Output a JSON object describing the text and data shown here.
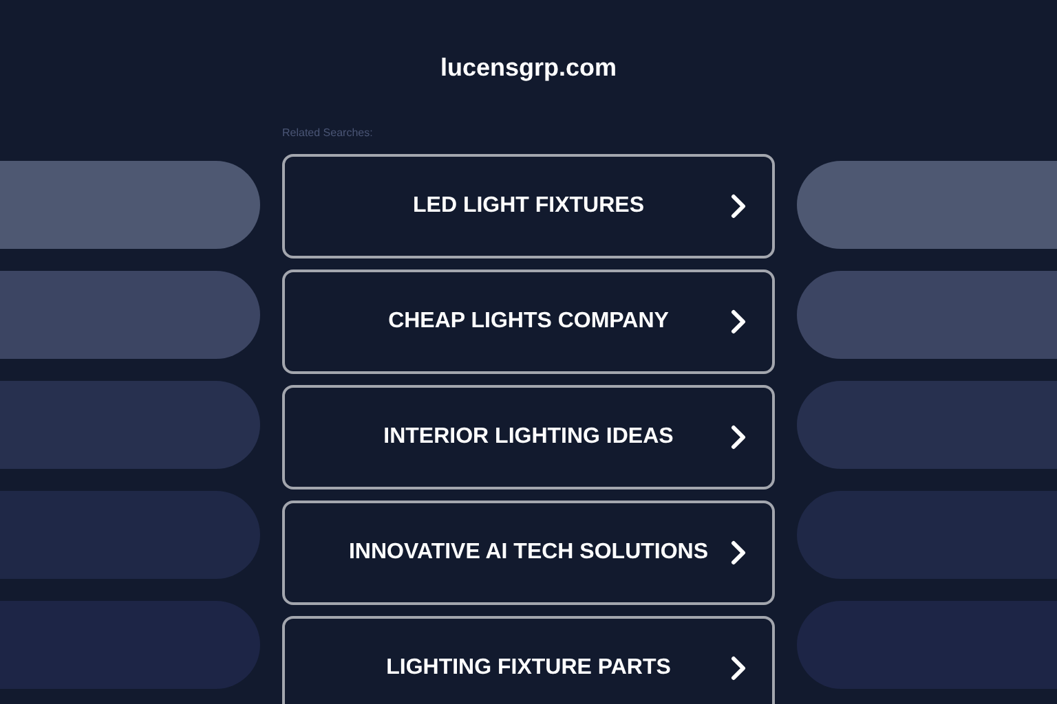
{
  "site_title": "lucensgrp.com",
  "related_label": "Related Searches:",
  "links": [
    {
      "label": "LED LIGHT FIXTURES"
    },
    {
      "label": "CHEAP LIGHTS COMPANY"
    },
    {
      "label": "INTERIOR LIGHTING IDEAS"
    },
    {
      "label": "INNOVATIVE AI TECH SOLUTIONS"
    },
    {
      "label": "LIGHTING FIXTURE PARTS"
    }
  ]
}
